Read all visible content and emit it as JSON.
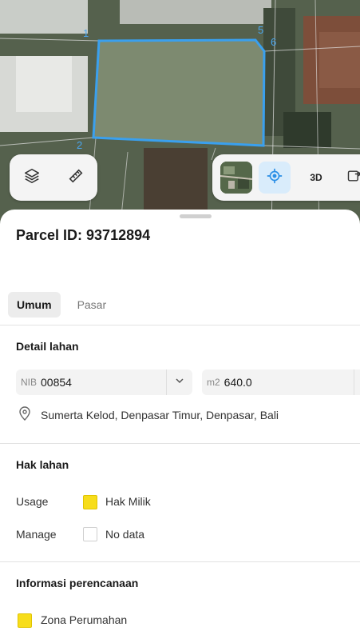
{
  "map": {
    "vertex_labels": [
      "1",
      "2",
      "5",
      "6"
    ],
    "parcel_outline_color": "#3aa0ee",
    "left_controls": {
      "layers_icon": "layers-icon",
      "measure_icon": "ruler-icon"
    },
    "right_controls": {
      "thumbnail": "satellite-thumbnail",
      "locate_icon": "crosshair-icon",
      "mode_3d_label": "3D",
      "more_icon": "export-icon"
    }
  },
  "sheet": {
    "parcel_id": "Parcel ID: 93712894",
    "tabs": [
      {
        "label": "Umum",
        "active": true
      },
      {
        "label": "Pasar",
        "active": false
      }
    ],
    "detail_lahan": {
      "title": "Detail lahan",
      "nib_prefix": "NIB",
      "nib_value": "00854",
      "area_prefix": "m2",
      "area_value": "640.0",
      "address": "Sumerta Kelod, Denpasar Timur, Denpasar, Bali"
    },
    "hak_lahan": {
      "title": "Hak lahan",
      "rows": [
        {
          "label": "Usage",
          "value": "Hak Milik",
          "color": "#f7dd1b"
        },
        {
          "label": "Manage",
          "value": "No data",
          "color": "#ffffff"
        }
      ]
    },
    "informasi": {
      "title": "Informasi perencanaan",
      "zone_label": "Zona Perumahan",
      "zone_color": "#f7dd1b"
    }
  }
}
